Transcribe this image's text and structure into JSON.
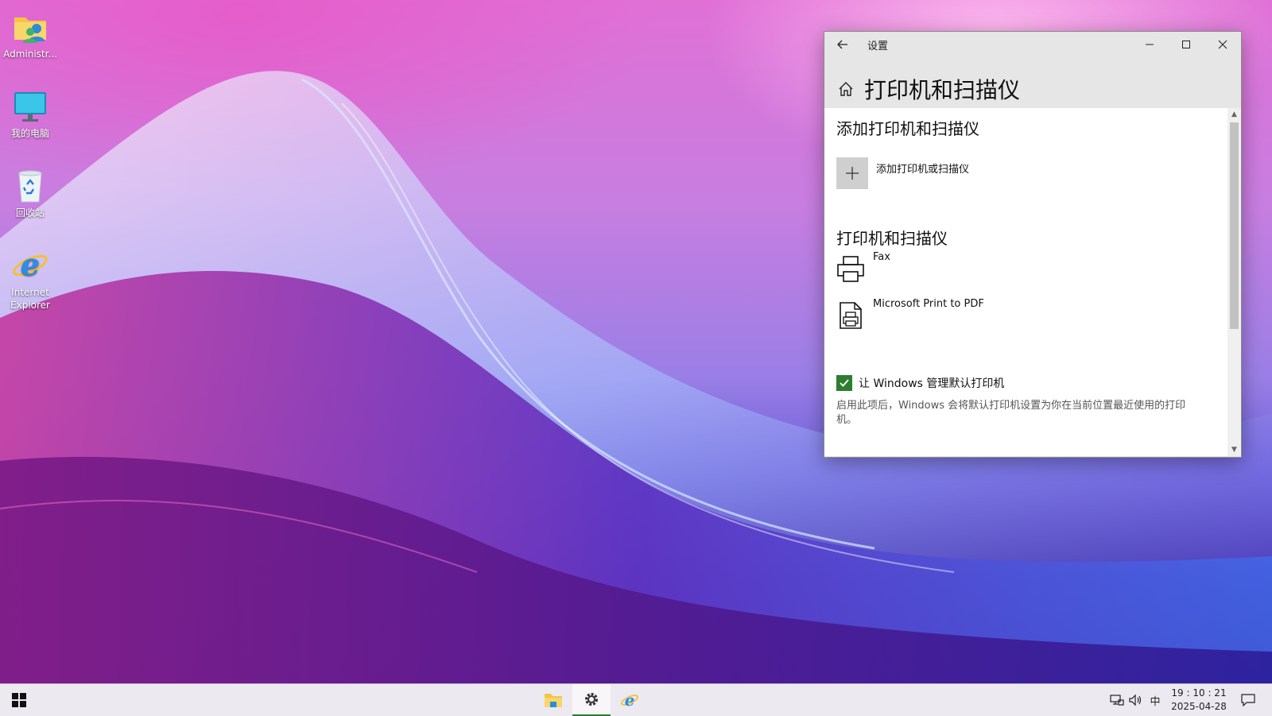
{
  "desktop": {
    "icons": [
      {
        "label": "Administr...",
        "icon": "user-folder-icon"
      },
      {
        "label": "我的电脑",
        "icon": "computer-icon"
      },
      {
        "label": "回收站",
        "icon": "recycle-bin-icon"
      },
      {
        "label": "Internet Explorer",
        "icon": "internet-explorer-icon"
      }
    ]
  },
  "window": {
    "title": "设置",
    "page_title": "打印机和扫描仪",
    "add_section_title": "添加打印机和扫描仪",
    "add_button_label": "添加打印机或扫描仪",
    "printers_section_title": "打印机和扫描仪",
    "devices": [
      {
        "name": "Fax",
        "icon": "fax-printer-icon"
      },
      {
        "name": "Microsoft Print to PDF",
        "icon": "pdf-printer-icon"
      }
    ],
    "default_printer_checkbox": {
      "label": "让 Windows 管理默认打印机",
      "checked": true
    },
    "default_printer_description": "启用此项后，Windows 会将默认打印机设置为你在当前位置最近使用的打印机。"
  },
  "taskbar": {
    "pinned": [
      "file-explorer-icon",
      "settings-icon",
      "internet-explorer-icon"
    ],
    "active": "settings-icon",
    "tray": {
      "ime": "中",
      "time": "19 : 10 : 21",
      "date": "2025-04-28"
    }
  },
  "colors": {
    "accent": "#2e7d32",
    "taskbar_active_underline": "#2e7d32"
  }
}
